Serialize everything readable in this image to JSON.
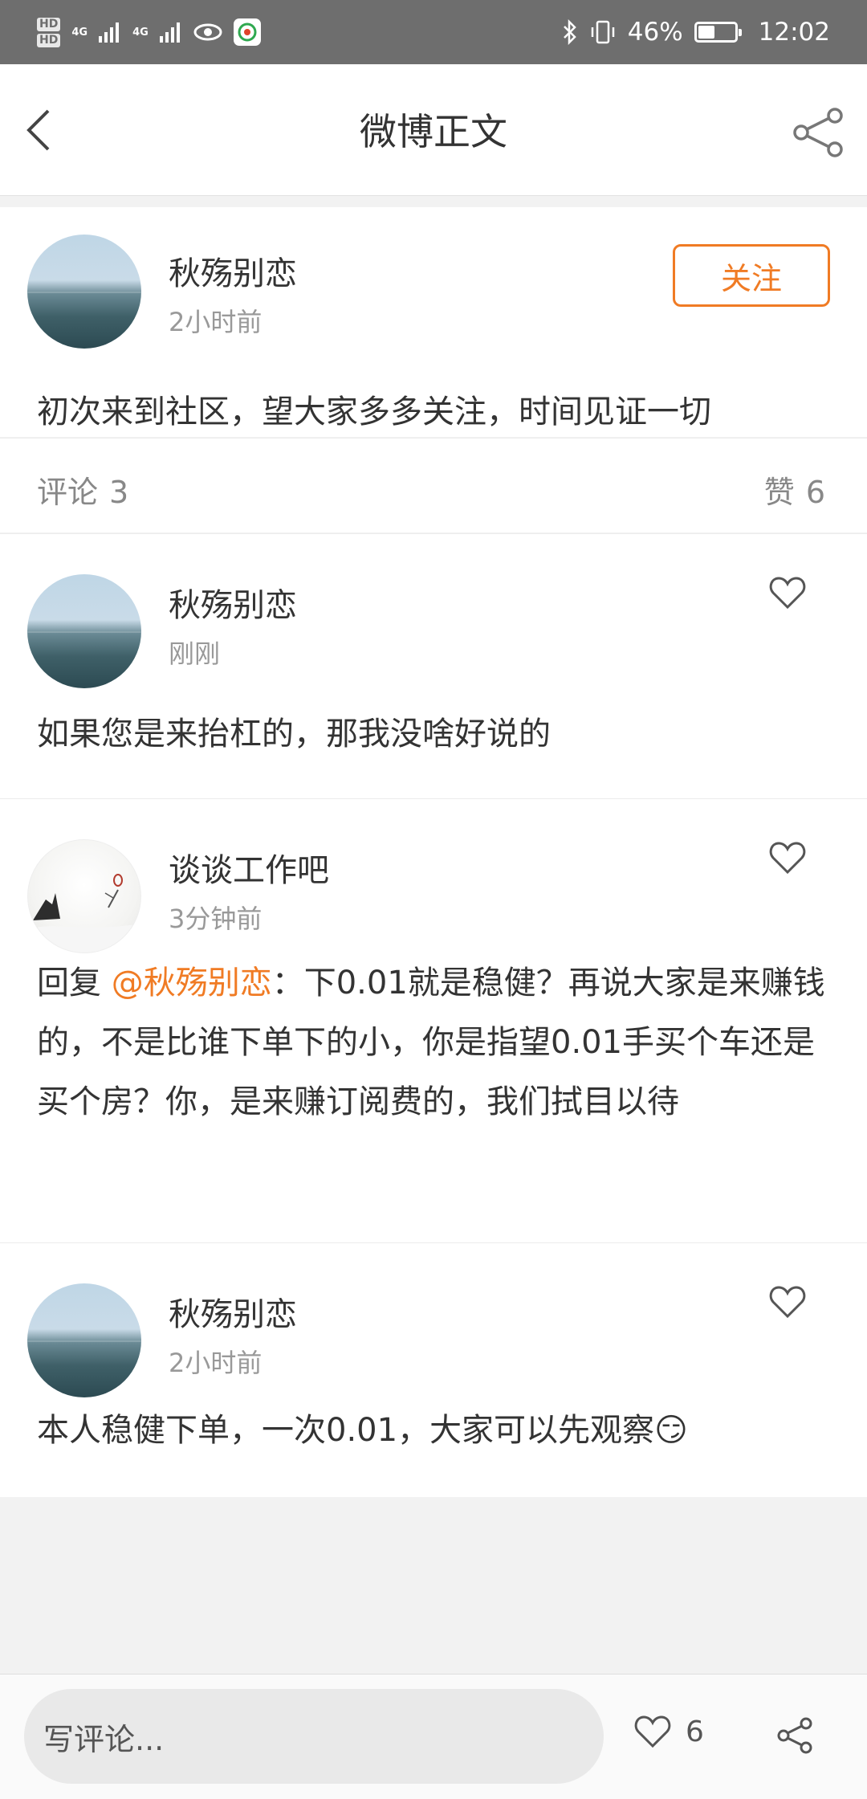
{
  "status_bar": {
    "hd1": "HD",
    "hd2": "HD",
    "net1": "4G",
    "net2": "4G",
    "battery_percent": "46%",
    "battery_level": 0.46,
    "time": "12:02"
  },
  "nav": {
    "title": "微博正文"
  },
  "post": {
    "author": "秋殇别恋",
    "time": "2小时前",
    "follow_label": "关注",
    "text": "初次来到社区，望大家多多关注，时间见证一切"
  },
  "stats": {
    "comments_label": "评论",
    "comments_count": "3",
    "likes_label": "赞",
    "likes_count": "6"
  },
  "comments": [
    {
      "author": "秋殇别恋",
      "time": "刚刚",
      "text": "如果您是来抬杠的，那我没啥好说的"
    },
    {
      "author": "谈谈工作吧",
      "time": "3分钟前",
      "reply_prefix": "回复 ",
      "mention": "@秋殇别恋",
      "text": "：下0.01就是稳健？再说大家是来赚钱的，不是比谁下单下的小，你是指望0.01手买个车还是买个房？你，是来赚订阅费的，我们拭目以待"
    },
    {
      "author": "秋殇别恋",
      "time": "2小时前",
      "text": "本人稳健下单，一次0.01，大家可以先观察",
      "emoji": "😏"
    }
  ],
  "bottom_bar": {
    "input_placeholder": "写评论...",
    "like_count": "6"
  },
  "colors": {
    "accent": "#f07b24",
    "status_bar": "#6e6e6e"
  },
  "icons": [
    "back-icon",
    "share-icon",
    "heart-icon",
    "eye-icon"
  ]
}
